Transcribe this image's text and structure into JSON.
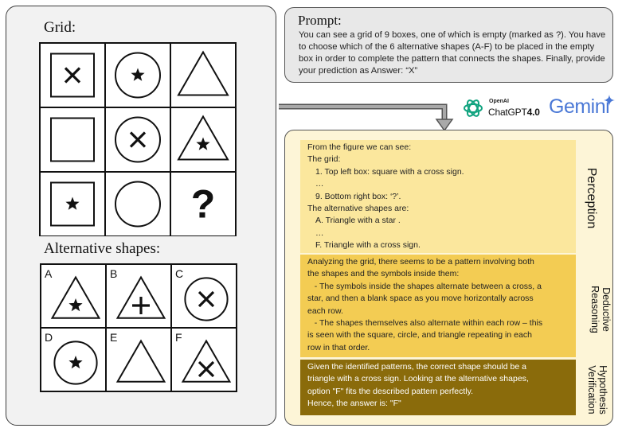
{
  "grid": {
    "title": "Grid:",
    "cells": [
      {
        "shape": "square",
        "symbol": "cross"
      },
      {
        "shape": "circle",
        "symbol": "star"
      },
      {
        "shape": "triangle",
        "symbol": "none"
      },
      {
        "shape": "square",
        "symbol": "none"
      },
      {
        "shape": "circle",
        "symbol": "cross"
      },
      {
        "shape": "triangle",
        "symbol": "star"
      },
      {
        "shape": "square",
        "symbol": "star"
      },
      {
        "shape": "circle",
        "symbol": "none"
      },
      {
        "shape": "question",
        "symbol": "?"
      }
    ]
  },
  "alternatives": {
    "title": "Alternative shapes:",
    "options": [
      {
        "label": "A",
        "shape": "triangle",
        "symbol": "star"
      },
      {
        "label": "B",
        "shape": "triangle",
        "symbol": "plus"
      },
      {
        "label": "C",
        "shape": "circle",
        "symbol": "cross"
      },
      {
        "label": "D",
        "shape": "circle",
        "symbol": "star"
      },
      {
        "label": "E",
        "shape": "triangle",
        "symbol": "none"
      },
      {
        "label": "F",
        "shape": "triangle",
        "symbol": "cross"
      }
    ]
  },
  "prompt": {
    "title": "Prompt:",
    "text": "You can see a grid of 9 boxes, one of which is empty (marked as ?). You have to choose which of the 6 alternative shapes (A-F) to be placed in the empty box in order to complete the pattern that connects the shapes. Finally, provide your prediction as Answer: “X”"
  },
  "models": {
    "openai_small": "OpenAI",
    "chatgpt": "ChatGPT",
    "chatgpt_version": "4.0",
    "gemini": "Gemini",
    "openai_icon": "openai-logo-icon",
    "gemini_icon": "sparkle-icon"
  },
  "response": {
    "perception": {
      "label": "Perception",
      "lines": [
        "From the figure we can see:",
        "The grid:",
        "1. Top left box: square with a cross sign.",
        "…",
        "9. Bottom right box: ‘?’.",
        "The alternative shapes are:",
        "A. Triangle with a star .",
        "…",
        "F. Triangle with a cross sign."
      ]
    },
    "deductive": {
      "label_line1": "Deductive",
      "label_line2": "Reasoning",
      "lines": [
        "Analyzing the grid, there seems to be a pattern involving both",
        "the shapes and the symbols inside them:",
        "   - The symbols inside the shapes alternate between a cross, a",
        "star, and then a blank space as you move horizontally across",
        "each row.",
        "   - The shapes themselves also alternate within each row – this",
        "is seen with the square, circle, and triangle repeating in each",
        "row in that order."
      ]
    },
    "hypothesis": {
      "label_line1": "Hypothesis",
      "label_line2": "Verification",
      "lines": [
        "Given the identified patterns, the correct shape should be a",
        "triangle with a cross sign. Looking at the alternative shapes,",
        "option \"F\" fits the described pattern perfectly.",
        "Hence, the answer is: \"F\""
      ]
    }
  },
  "colors": {
    "perception_band": "#fbe79d",
    "deductive_band": "#f3cc53",
    "hypothesis_band": "#8a6b0b",
    "response_bg": "#fdf5d7",
    "gemini_blue": "#4a78d6",
    "openai_green": "#10a37f"
  }
}
